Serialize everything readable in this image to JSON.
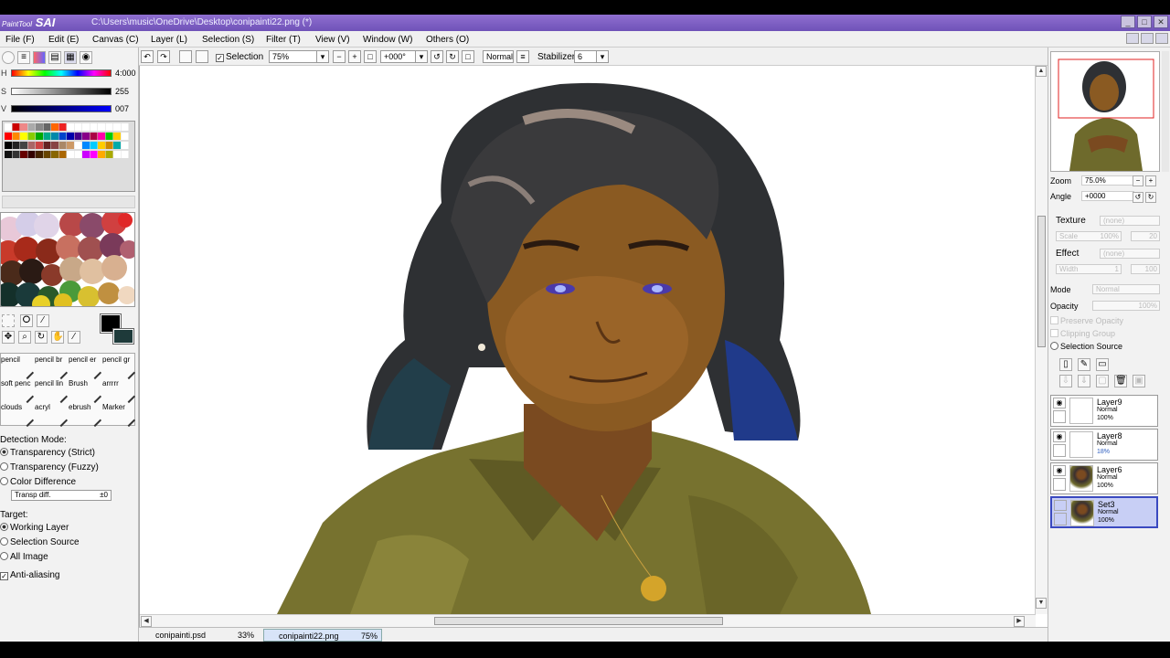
{
  "app": {
    "logo_small": "PaintTool",
    "logo_big": "SAI",
    "title_path": "C:\\Users\\music\\OneDrive\\Desktop\\conipainti22.png (*)"
  },
  "menu": [
    "File (F)",
    "Edit (E)",
    "Canvas (C)",
    "Layer (L)",
    "Selection (S)",
    "Filter (T)",
    "View (V)",
    "Window (W)",
    "Others (O)"
  ],
  "color": {
    "h_label": "H",
    "h_value": "4:000",
    "s_label": "S",
    "s_value": "255",
    "v_label": "V",
    "v_value": "007",
    "fg": "#000000",
    "bg": "#1e3a3a"
  },
  "brushes": [
    "pencil",
    "pencil br",
    "pencil er",
    "pencil gr",
    "soft penc",
    "pencil lin",
    "Brush",
    "arrrrr",
    "clouds",
    "acryl",
    "ebrush",
    "Marker"
  ],
  "detection": {
    "title": "Detection Mode:",
    "options": [
      "Transparency (Strict)",
      "Transparency (Fuzzy)",
      "Color Difference"
    ],
    "selected": 0,
    "transp_label": "Transp diff.",
    "transp_value": "±0",
    "target_title": "Target:",
    "targets": [
      "Working Layer",
      "Selection Source",
      "All Image"
    ],
    "target_selected": 0,
    "antialias": "Anti-aliasing"
  },
  "toolbar": {
    "selection_label": "Selection",
    "zoom": "75%",
    "angle": "+000°",
    "blend": "Normal",
    "stabilizer_label": "Stabilizer",
    "stabilizer_value": "6"
  },
  "tabs": [
    {
      "name": "conipainti.psd",
      "pct": "33%",
      "active": false
    },
    {
      "name": "conipainti22.png",
      "pct": "75%",
      "active": true
    }
  ],
  "navigator": {
    "zoom_label": "Zoom",
    "zoom_value": "75.0%",
    "angle_label": "Angle",
    "angle_value": "+0000"
  },
  "props": {
    "texture_label": "Texture",
    "texture_value": "(none)",
    "scale_label": "Scale",
    "scale_value": "100%",
    "scale_num": "20",
    "effect_label": "Effect",
    "effect_value": "(none)",
    "width_label": "Width",
    "width_value": "1",
    "width_num": "100",
    "mode_label": "Mode",
    "mode_value": "Normal",
    "opacity_label": "Opacity",
    "opacity_value": "100%",
    "preserve": "Preserve Opacity",
    "clipping": "Clipping Group",
    "selection_source": "Selection Source"
  },
  "layers": [
    {
      "name": "Layer9",
      "mode": "Normal",
      "opacity": "100%",
      "visible": true,
      "selected": false,
      "has_art": false
    },
    {
      "name": "Layer8",
      "mode": "Normal",
      "opacity": "18%",
      "visible": true,
      "selected": false,
      "has_art": false
    },
    {
      "name": "Layer6",
      "mode": "Normal",
      "opacity": "100%",
      "visible": true,
      "selected": false,
      "has_art": true
    },
    {
      "name": "Set3",
      "mode": "Normal",
      "opacity": "100%",
      "visible": false,
      "selected": true,
      "has_art": true
    }
  ]
}
